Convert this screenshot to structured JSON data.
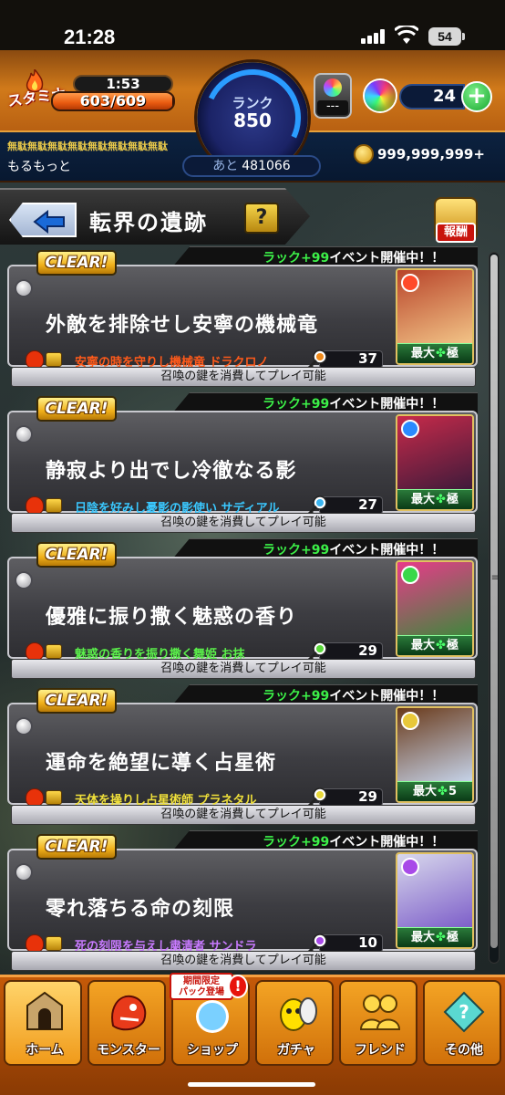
{
  "status_bar": {
    "time": "21:28",
    "battery": "54"
  },
  "hud": {
    "stamina_label": "スタミナ",
    "stamina_timer": "1:53",
    "stamina_count": "603/609",
    "stamina_fraction": 0.99,
    "rank_label": "ランク",
    "rank_value": "850",
    "rank_next_label": "あと",
    "rank_next_value": "481066",
    "crystal_box_text": "---",
    "orb_count": "24",
    "orb_plus": "+",
    "player_title": "無駄無駄無駄無駄無駄無駄無駄無駄",
    "player_name": "もるもっと",
    "coins": "999,999,999+"
  },
  "header": {
    "title": "転界の遺跡",
    "help": "?",
    "reward_badge": "報酬"
  },
  "quests": [
    {
      "clear": "CLEAR!",
      "event_highlight": "ラック+99",
      "event_suffix": "イベント開催中！！",
      "title": "外敵を排除せし安寧の機械竜",
      "boss": "安寧の時を守りし機械竜 ドラクロノ",
      "boss_color": "#ff5a1a",
      "key_color": "#f08a1a",
      "keys": "37",
      "luck_prefix": "最大",
      "luck_suffix": "極",
      "element_color": "#ff4a2a",
      "art_top": "#b8442a",
      "art_bottom": "#f4c88a",
      "footer": "召喚の鍵を消費してプレイ可能"
    },
    {
      "clear": "CLEAR!",
      "event_highlight": "ラック+99",
      "event_suffix": "イベント開催中！！",
      "title": "静寂より出でし冷徹なる影",
      "boss": "日陰を好みし憂影の影使い サディアル",
      "boss_color": "#3ac8ff",
      "key_color": "#3ab4f0",
      "keys": "27",
      "luck_prefix": "最大",
      "luck_suffix": "極",
      "element_color": "#2a8aff",
      "art_top": "#c82a4a",
      "art_bottom": "#3a1a3a",
      "footer": "召喚の鍵を消費してプレイ可能"
    },
    {
      "clear": "CLEAR!",
      "event_highlight": "ラック+99",
      "event_suffix": "イベント開催中！！",
      "title": "優雅に振り撒く魅惑の香り",
      "boss": "魅惑の香りを振り撒く舞姫 お抹",
      "boss_color": "#5af04a",
      "key_color": "#5ad83a",
      "keys": "29",
      "luck_prefix": "最大",
      "luck_suffix": "極",
      "element_color": "#3ad84a",
      "art_top": "#e83a8a",
      "art_bottom": "#3a8a3a",
      "footer": "召喚の鍵を消費してプレイ可能"
    },
    {
      "clear": "CLEAR!",
      "event_highlight": "ラック+99",
      "event_suffix": "イベント開催中！！",
      "title": "運命を絶望に導く占星術",
      "boss": "天体を操りし占星術師 プラネタル",
      "boss_color": "#f0e03a",
      "key_color": "#e8d83a",
      "keys": "29",
      "luck_prefix": "最大",
      "luck_suffix": "5",
      "element_color": "#e8c83a",
      "art_top": "#6a3a1a",
      "art_bottom": "#c8d8f0",
      "footer": "召喚の鍵を消費してプレイ可能"
    },
    {
      "clear": "CLEAR!",
      "event_highlight": "ラック+99",
      "event_suffix": "イベント開催中！！",
      "title": "零れ落ちる命の刻限",
      "boss": "死の刻限を与えし粛清者 サンドラ",
      "boss_color": "#c87aff",
      "key_color": "#a84ae8",
      "keys": "10",
      "luck_prefix": "最大",
      "luck_suffix": "極",
      "element_color": "#a84ae8",
      "art_top": "#d8d8ec",
      "art_bottom": "#7a5ac8",
      "footer": "召喚の鍵を消費してプレイ可能"
    }
  ],
  "nav": {
    "items": [
      {
        "label": "ホーム"
      },
      {
        "label": "モンスター"
      },
      {
        "label": "ショップ"
      },
      {
        "label": "ガチャ"
      },
      {
        "label": "フレンド"
      },
      {
        "label": "その他"
      }
    ],
    "limited_tag_line1": "期間限定",
    "limited_tag_line2": "パック登場",
    "alert": "!"
  }
}
